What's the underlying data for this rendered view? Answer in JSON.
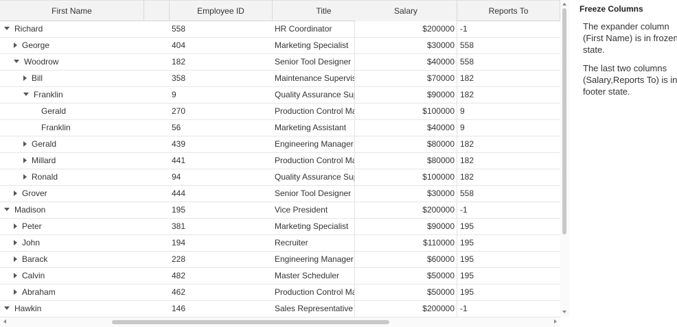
{
  "columns": [
    "First Name",
    "",
    "Employee ID",
    "Title",
    "Salary",
    "Reports To"
  ],
  "rows": [
    {
      "name": "Richard",
      "level": 0,
      "expander": "down",
      "id": "558",
      "title": "HR Coordinator",
      "salary": "$200000",
      "reports": "-1"
    },
    {
      "name": "George",
      "level": 1,
      "expander": "right",
      "id": "404",
      "title": "Marketing Specialist",
      "salary": "$30000",
      "reports": "558"
    },
    {
      "name": "Woodrow",
      "level": 1,
      "expander": "down",
      "id": "182",
      "title": "Senior Tool Designer",
      "salary": "$40000",
      "reports": "558"
    },
    {
      "name": "Bill",
      "level": 2,
      "expander": "right",
      "id": "358",
      "title": "Maintenance Supervis",
      "salary": "$70000",
      "reports": "182"
    },
    {
      "name": "Franklin",
      "level": 2,
      "expander": "down",
      "id": "9",
      "title": "Quality Assurance Sup",
      "salary": "$90000",
      "reports": "182"
    },
    {
      "name": "Gerald",
      "level": 3,
      "expander": "none",
      "id": "270",
      "title": "Production Control Ma",
      "salary": "$100000",
      "reports": "9"
    },
    {
      "name": "Franklin",
      "level": 3,
      "expander": "none",
      "id": "56",
      "title": "Marketing Assistant",
      "salary": "$40000",
      "reports": "9"
    },
    {
      "name": "Gerald",
      "level": 2,
      "expander": "right",
      "id": "439",
      "title": "Engineering Manager",
      "salary": "$80000",
      "reports": "182"
    },
    {
      "name": "Millard",
      "level": 2,
      "expander": "right",
      "id": "441",
      "title": "Production Control Ma",
      "salary": "$80000",
      "reports": "182"
    },
    {
      "name": "Ronald",
      "level": 2,
      "expander": "right",
      "id": "94",
      "title": "Quality Assurance Sup",
      "salary": "$100000",
      "reports": "182"
    },
    {
      "name": "Grover",
      "level": 1,
      "expander": "right",
      "id": "444",
      "title": "Senior Tool Designer",
      "salary": "$30000",
      "reports": "558"
    },
    {
      "name": "Madison",
      "level": 0,
      "expander": "down",
      "id": "195",
      "title": "Vice President",
      "salary": "$200000",
      "reports": "-1"
    },
    {
      "name": "Peter",
      "level": 1,
      "expander": "right",
      "id": "381",
      "title": "Marketing Specialist",
      "salary": "$90000",
      "reports": "195"
    },
    {
      "name": "John",
      "level": 1,
      "expander": "right",
      "id": "194",
      "title": "Recruiter",
      "salary": "$110000",
      "reports": "195"
    },
    {
      "name": "Barack",
      "level": 1,
      "expander": "right",
      "id": "228",
      "title": "Engineering Manager",
      "salary": "$60000",
      "reports": "195"
    },
    {
      "name": "Calvin",
      "level": 1,
      "expander": "right",
      "id": "482",
      "title": "Master Scheduler",
      "salary": "$50000",
      "reports": "195"
    },
    {
      "name": "Abraham",
      "level": 1,
      "expander": "right",
      "id": "462",
      "title": "Production Control Ma",
      "salary": "$50000",
      "reports": "195"
    },
    {
      "name": "Hawkin",
      "level": 0,
      "expander": "down",
      "id": "146",
      "title": "Sales Representative",
      "salary": "$200000",
      "reports": "-1"
    }
  ],
  "side_panel": {
    "title": "Freeze Columns",
    "para1": "The expander column (First Name) is in frozen state.",
    "para2": "The last two columns (Salary,Reports To) is in footer state."
  }
}
